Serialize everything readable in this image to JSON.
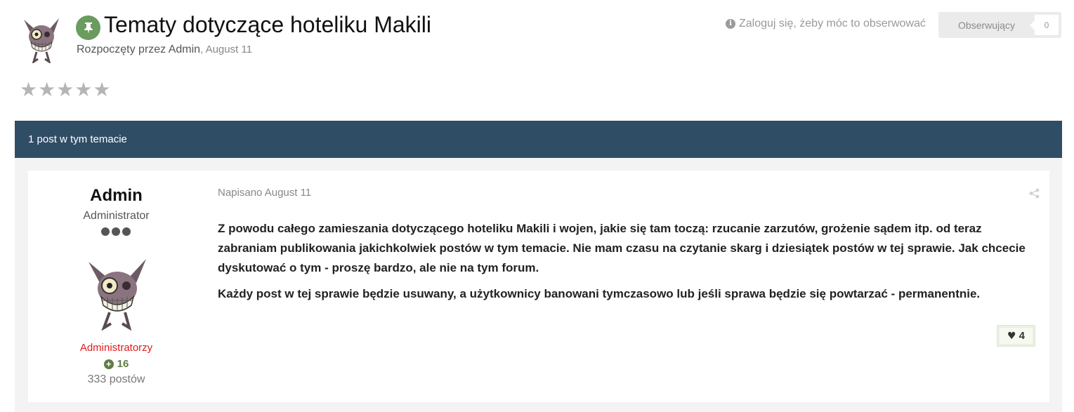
{
  "topic": {
    "title": "Tematy dotyczące hoteliku Makili",
    "started_by": "Rozpoczęty przez Admin",
    "started_date": ", August 11",
    "pin_icon": "pin-icon",
    "avatar_icon": "gremlin-avatar-icon"
  },
  "follow": {
    "login_note": "Zaloguj się, żeby móc to obserwować",
    "info_icon": "info-icon",
    "button_label": "Obserwujący",
    "count": "0"
  },
  "rating": {
    "stars": 5,
    "filled": 0,
    "symbol": "★"
  },
  "posts_bar": {
    "label": "1 post w tym temacie"
  },
  "post": {
    "author": {
      "name": "Admin",
      "role": "Administrator",
      "group": "Administratorzy",
      "reputation": "16",
      "post_count": "333 postów"
    },
    "date": "Napisano August 11",
    "paragraphs": [
      "Z powodu całego zamieszania dotyczącego hoteliku Makili i wojen, jakie się tam toczą: rzucanie zarzutów, grożenie sądem itp. od teraz zabraniam publikowania jakichkolwiek postów w tym temacie. Nie mam czasu na czytanie skarg i dziesiątek postów w tej sprawie. Jak chcecie dyskutować o tym - proszę bardzo, ale nie na tym forum.",
      "Każdy post w tej sprawie będzie usuwany, a użytkownicy banowani tymczasowo lub jeśli sprawa będzie się powtarzać - permanentnie."
    ],
    "likes": "4"
  },
  "colors": {
    "bar": "#304d66",
    "pin": "#6b9b5e",
    "group": "#e01b1b",
    "reputation": "#5d7d45",
    "area": "#f3f3f3"
  }
}
